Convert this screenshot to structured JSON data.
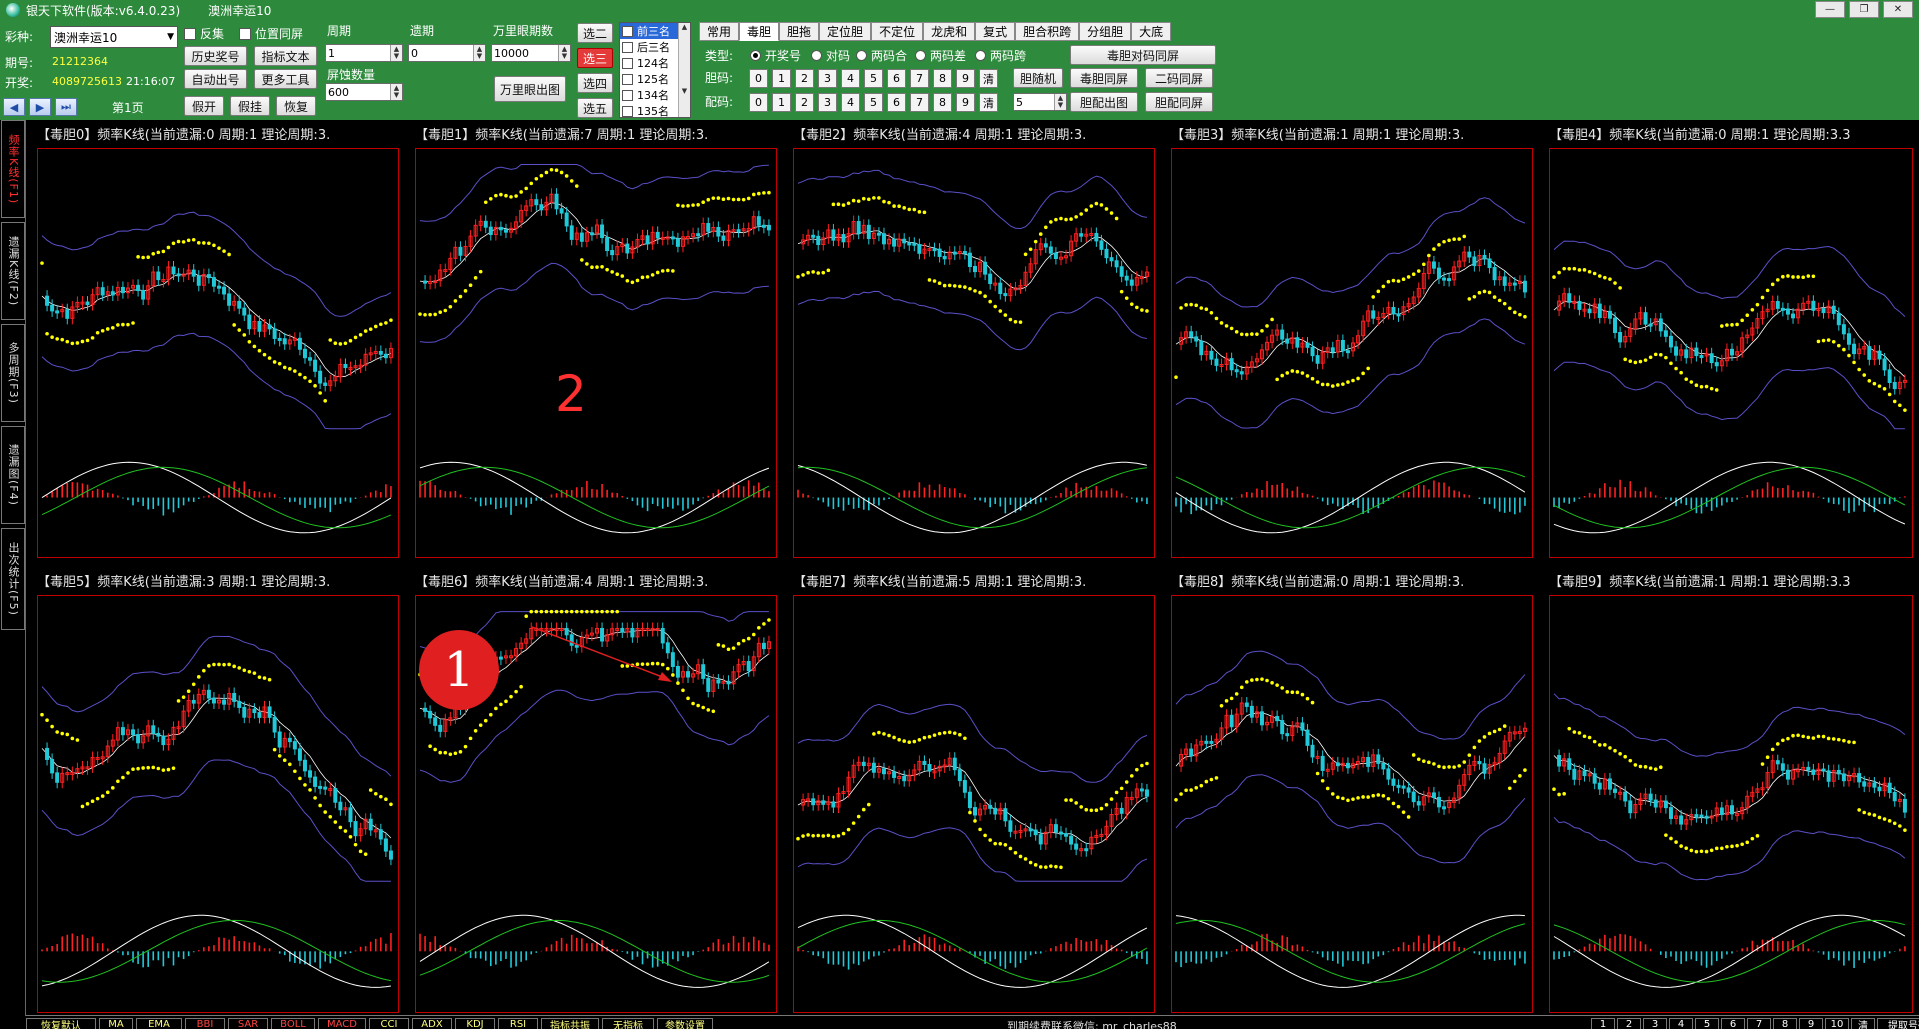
{
  "titlebar": {
    "app_title": "银天下软件(版本:v6.4.0.23)",
    "lottery_title": "澳洲幸运10"
  },
  "toolbar": {
    "lottery_label": "彩种:",
    "lottery_value": "澳洲幸运10",
    "period_label": "期号:",
    "period_value": "21212364",
    "draw_label": "开奖:",
    "draw_value": "4089725613",
    "draw_time": "21:16:07",
    "page_label": "第1页",
    "chk_fanji": "反集",
    "chk_weizhi": "位置同屏",
    "btn_history": "历史奖号",
    "btn_indicator_text": "指标文本",
    "btn_auto": "自动出号",
    "btn_more": "更多工具",
    "btn_fankai": "假开",
    "btn_jiagua": "假挂",
    "btn_huifu": "恢复",
    "cycle_label": "周期",
    "cycle_value": "1",
    "miss_label": "遗期",
    "miss_value": "0",
    "wanli_label": "万里眼期数",
    "wanli_value": "10000",
    "screen_label": "屏蚀数量",
    "screen_value": "600",
    "btn_wanli": "万里眼出图",
    "sel_btns": [
      "选二",
      "选三",
      "选四",
      "选五"
    ],
    "list_items": [
      {
        "label": "前三名",
        "checked": true,
        "active": true
      },
      {
        "label": "后三名",
        "checked": false,
        "active": false
      },
      {
        "label": "124名",
        "checked": false,
        "active": false
      },
      {
        "label": "125名",
        "checked": false,
        "active": false
      },
      {
        "label": "134名",
        "checked": false,
        "active": false
      },
      {
        "label": "135名",
        "checked": false,
        "active": false
      }
    ],
    "tabs": [
      "常用",
      "毒胆",
      "胆拖",
      "定位胆",
      "不定位",
      "龙虎和",
      "复式",
      "胆合积跨",
      "分组胆",
      "大底"
    ],
    "type_label": "类型:",
    "radios": [
      "开奖号",
      "对码",
      "两码合",
      "两码差",
      "两码跨"
    ],
    "btn_duidui": "毒胆对码同屏",
    "dan_label": "胆码:",
    "pei_label": "配码:",
    "nums": [
      "0",
      "1",
      "2",
      "3",
      "4",
      "5",
      "6",
      "7",
      "8",
      "9"
    ],
    "clear": "清",
    "btn_suiji": "胆随机",
    "btn_dudan": "毒胆同屏",
    "btn_erma": "二码同屏",
    "pei_value": "5",
    "btn_peichu": "胆配出图",
    "btn_peitong": "胆配同屏"
  },
  "sidetabs": [
    {
      "label": "频率K线(F1)",
      "active": true
    },
    {
      "label": "遗漏K线(F2)",
      "active": false
    },
    {
      "label": "多周期(F3)",
      "active": false
    },
    {
      "label": "遗漏图(F4)",
      "active": false
    },
    {
      "label": "出次统计(F5)",
      "active": false
    }
  ],
  "charts": [
    {
      "title": "【毒胆0】频率K线(当前遗漏:0 周期:1 理论周期:3."
    },
    {
      "title": "【毒胆1】频率K线(当前遗漏:7 周期:1 理论周期:3."
    },
    {
      "title": "【毒胆2】频率K线(当前遗漏:4 周期:1 理论周期:3."
    },
    {
      "title": "【毒胆3】频率K线(当前遗漏:1 周期:1 理论周期:3."
    },
    {
      "title": "【毒胆4】频率K线(当前遗漏:0 周期:1 理论周期:3.3"
    },
    {
      "title": "【毒胆5】频率K线(当前遗漏:3 周期:1 理论周期:3."
    },
    {
      "title": "【毒胆6】频率K线(当前遗漏:4 周期:1 理论周期:3."
    },
    {
      "title": "【毒胆7】频率K线(当前遗漏:5 周期:1 理论周期:3."
    },
    {
      "title": "【毒胆8】频率K线(当前遗漏:0 周期:1 理论周期:3."
    },
    {
      "title": "【毒胆9】频率K线(当前遗漏:1 周期:1 理论周期:3.3"
    }
  ],
  "annotations": {
    "circle_label": "1",
    "label_2": "2"
  },
  "bottombar": {
    "left_btns": [
      "恢复默认",
      "MA",
      "EMA",
      "BBI",
      "SAR",
      "BOLL",
      "MACD",
      "CCI",
      "ADX",
      "KDJ",
      "RSI",
      "指标共振",
      "无指标",
      "参数设置"
    ],
    "red_btns": [
      "BBI",
      "SAR",
      "BOLL",
      "MACD"
    ],
    "contact": "到期续费联系微信: mr_charles88",
    "right_btns": [
      "1",
      "2",
      "3",
      "4",
      "5",
      "6",
      "7",
      "8",
      "9",
      "10",
      "清",
      "提取号码"
    ]
  },
  "colors": {
    "toolbar_bg": "#2e8b3d",
    "rise": "#ff2020",
    "fall": "#20c8d8",
    "ma": "#ffff00",
    "boll": "#6a5acd"
  }
}
